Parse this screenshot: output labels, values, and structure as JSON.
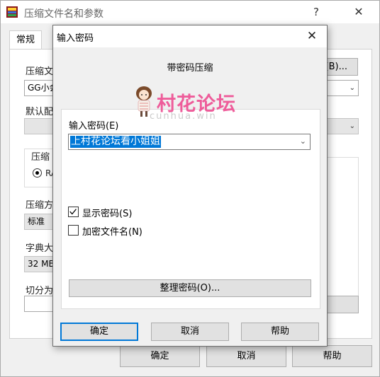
{
  "background_window": {
    "title": "压缩文件名和参数",
    "help_button": "?",
    "close_button": "✕",
    "tab_label": "常规",
    "archive_name_label": "压缩文",
    "browse_button": "(B)...",
    "archive_name_value": "GG小会",
    "profile_label": "默认配",
    "format_group_label": "压缩",
    "format_option": "RA",
    "right_radio_partial": ")",
    "method_label": "压缩方",
    "method_value": "标准",
    "dict_label": "字典大",
    "dict_value": "32 MB",
    "split_label": "切分为",
    "ok_button": "确定",
    "cancel_button": "取消",
    "help_button_bottom": "帮助"
  },
  "dialog": {
    "title": "输入密码",
    "close_button": "✕",
    "subtitle": "带密码压缩",
    "password_label": "输入密码(E)",
    "password_value": "上村花论坛看小姐姐",
    "show_password_label": "显示密码(S)",
    "show_password_checked": true,
    "encrypt_filenames_label": "加密文件名(N)",
    "encrypt_filenames_checked": false,
    "organize_button": "整理密码(O)...",
    "ok_button": "确定",
    "cancel_button": "取消",
    "help_button": "帮助"
  },
  "watermark": {
    "text": "村花论坛",
    "subtext": "cunhua.win"
  },
  "colors": {
    "accent": "#0078d7",
    "watermark": "#ee5c9a"
  }
}
